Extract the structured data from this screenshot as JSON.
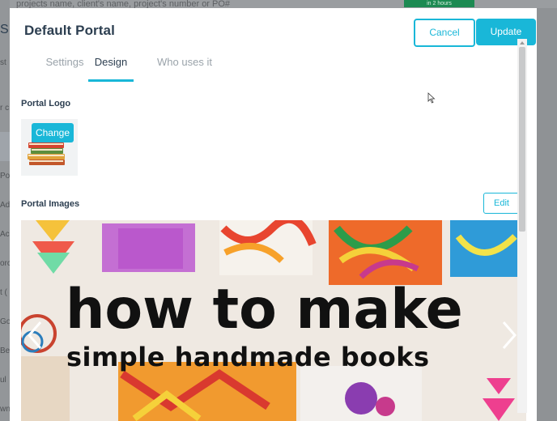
{
  "background": {
    "topbar_text": "projects name, client's name, project's number or PO#",
    "badge_text": "in 2 hours",
    "side_fragments": [
      "S",
      "st",
      "r c",
      "Por",
      "Ad",
      "Ac",
      "orc",
      "t (",
      "Go",
      "Be",
      "ul",
      "wn"
    ]
  },
  "modal": {
    "title": "Default Portal",
    "cancel_label": "Cancel",
    "update_label": "Update",
    "tabs": [
      {
        "label": "Settings",
        "active": false
      },
      {
        "label": "Design",
        "active": true
      },
      {
        "label": "Who uses it",
        "active": false
      }
    ],
    "portal_logo_label": "Portal Logo",
    "change_label": "Change",
    "portal_images_label": "Portal Images",
    "edit_label": "Edit",
    "carousel": {
      "headline": "how to make",
      "subline": "simple handmade books"
    }
  },
  "colors": {
    "accent": "#19b7d8",
    "title": "#2c3e50",
    "tab_inactive": "#9aa3aa"
  },
  "icons": {
    "prev": "chevron-left-icon",
    "next": "chevron-right-icon",
    "logo": "books-icon",
    "cursor": "mouse-pointer-icon"
  }
}
